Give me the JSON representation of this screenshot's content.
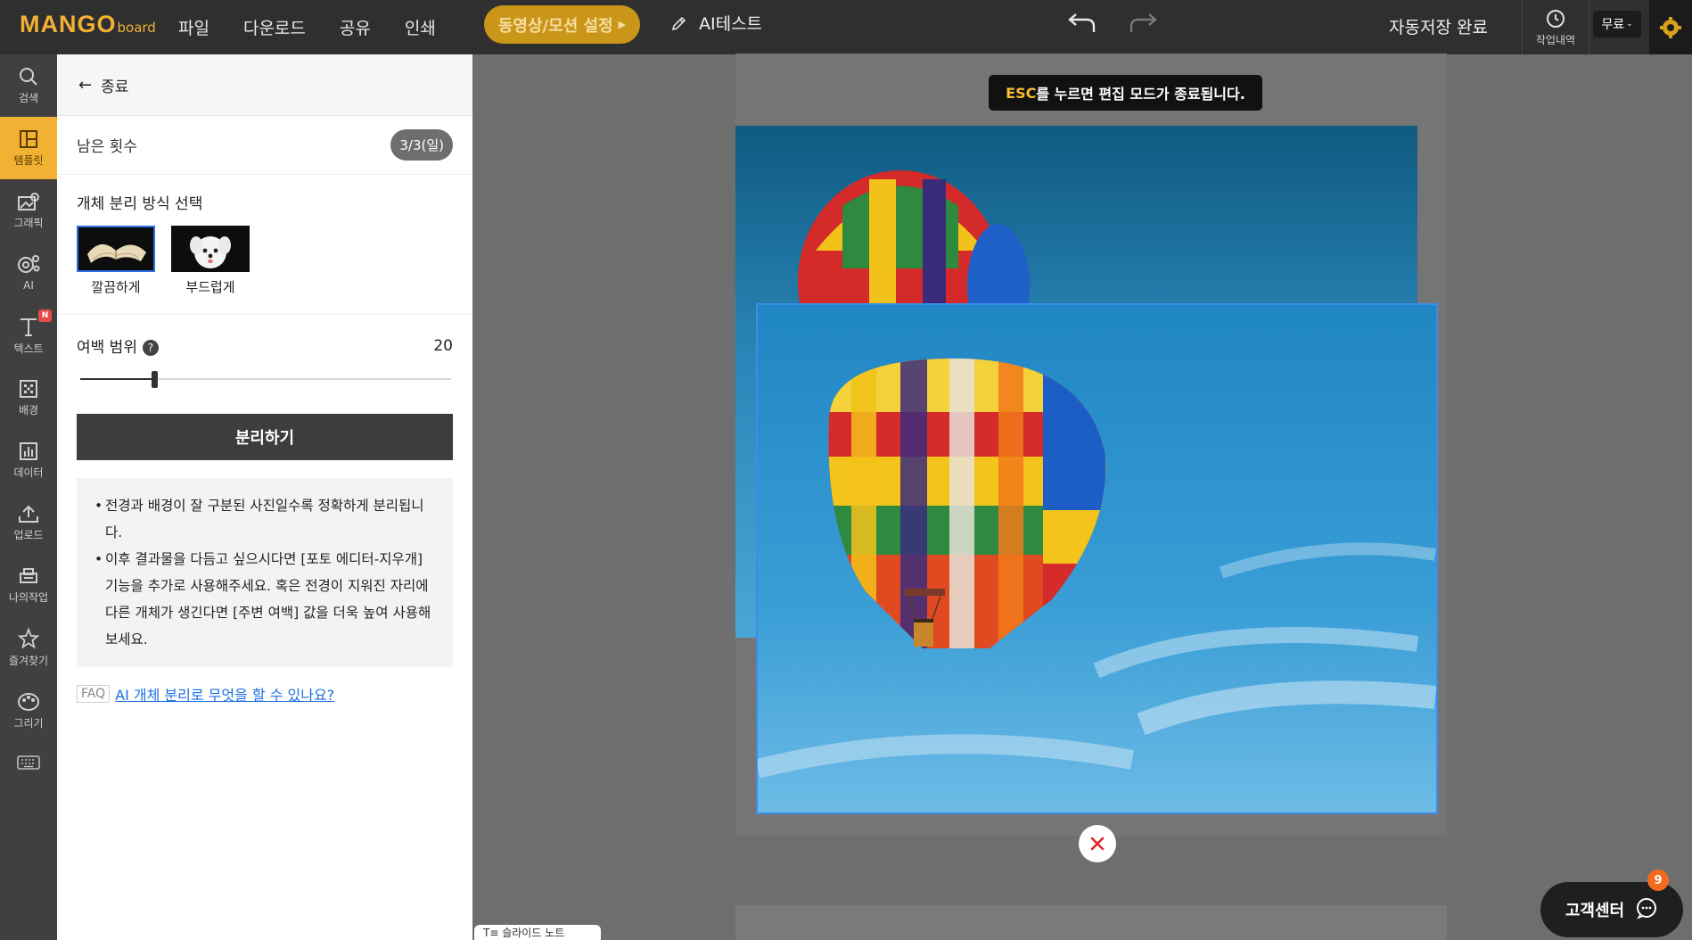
{
  "brand": {
    "logo_main": "MANGO",
    "logo_sub": "board"
  },
  "menu": [
    "파일",
    "다운로드",
    "공유",
    "인쇄"
  ],
  "video_button": "동영상/모션 설정",
  "doc_title": "AI테스트",
  "autosave": "자동저장 완료",
  "history_label": "작업내역",
  "plan_badge": "무료",
  "sidebar": [
    {
      "label": "검색",
      "icon": "search-icon"
    },
    {
      "label": "템플릿",
      "icon": "template-icon",
      "active": true
    },
    {
      "label": "그래픽",
      "icon": "graphic-icon"
    },
    {
      "label": "AI",
      "icon": "ai-icon"
    },
    {
      "label": "텍스트",
      "icon": "text-icon",
      "badge": "N"
    },
    {
      "label": "배경",
      "icon": "background-icon"
    },
    {
      "label": "데이터",
      "icon": "chart-icon"
    },
    {
      "label": "업로드",
      "icon": "upload-icon"
    },
    {
      "label": "나의작업",
      "icon": "my-work-icon"
    },
    {
      "label": "즐겨찾기",
      "icon": "star-icon"
    },
    {
      "label": "그리기",
      "icon": "draw-icon"
    }
  ],
  "panel": {
    "back_label": "종료",
    "remain_label": "남은 횟수",
    "remain_value": "3/3(일)",
    "method_title": "개체 분리 방식 선택",
    "methods": [
      {
        "label": "깔끔하게",
        "selected": true
      },
      {
        "label": "부드럽게",
        "selected": false
      }
    ],
    "margin_label": "여백 범위",
    "margin_value": "20",
    "margin_fraction": 0.2,
    "separate_button": "분리하기",
    "tips": [
      "전경과 배경이 잘 구분된 사진일수록 정확하게 분리됩니다.",
      "이후 결과물을 다듬고 싶으시다면 [포토 에디터-지우개] 기능을 추가로 사용해주세요. 혹은 전경이 지워진 자리에 다른 개체가 생긴다면 [주변 여백] 값을 더욱 높여 사용해보세요."
    ],
    "faq_tag": "FAQ",
    "faq_link": "AI 개체 분리로 무엇을 할 수 있나요?"
  },
  "canvas": {
    "esc_key": "ESC",
    "esc_rest": "를 누르면 편집 모드가 종료됩니다.",
    "slide_tab": "T≡ 슬라이드 노트"
  },
  "support": {
    "label": "고객센터",
    "badge": "9"
  },
  "colors": {
    "accent": "#f2b132",
    "selection": "#3d8de8",
    "sky": "#2a8fc8"
  }
}
